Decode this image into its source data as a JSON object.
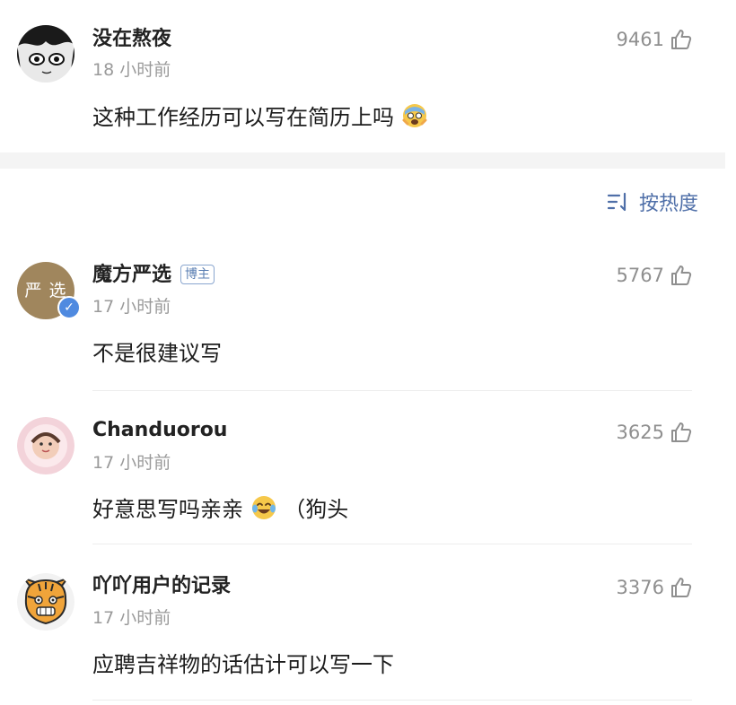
{
  "comments": [
    {
      "username": "没在熬夜",
      "time": "18 小时前",
      "text": "这种工作经历可以写在简历上吗",
      "likes": "9461"
    },
    {
      "username": "魔方严选",
      "badge": "博主",
      "avatar_text": "严 选",
      "time": "17 小时前",
      "text": "不是很建议写",
      "likes": "5767"
    },
    {
      "username": "Chanduorou",
      "time": "17 小时前",
      "text": "好意思写吗亲亲",
      "text_suffix": "（狗头",
      "likes": "3625"
    },
    {
      "username": "吖吖用户的记录",
      "time": "17 小时前",
      "text": "应聘吉祥物的话估计可以写一下",
      "likes": "3376"
    }
  ],
  "sort": {
    "label": "按热度"
  },
  "icons": {
    "like": "thumbs-up-icon",
    "sort": "sort-icon",
    "verified": "verified-check-icon",
    "emoji_1": "scared-face-emoji",
    "emoji_2": "laughing-tears-emoji"
  },
  "colors": {
    "accent": "#4f6fa8",
    "secondary_text": "#9a9a9a",
    "badge_border": "#8aa6cf"
  }
}
